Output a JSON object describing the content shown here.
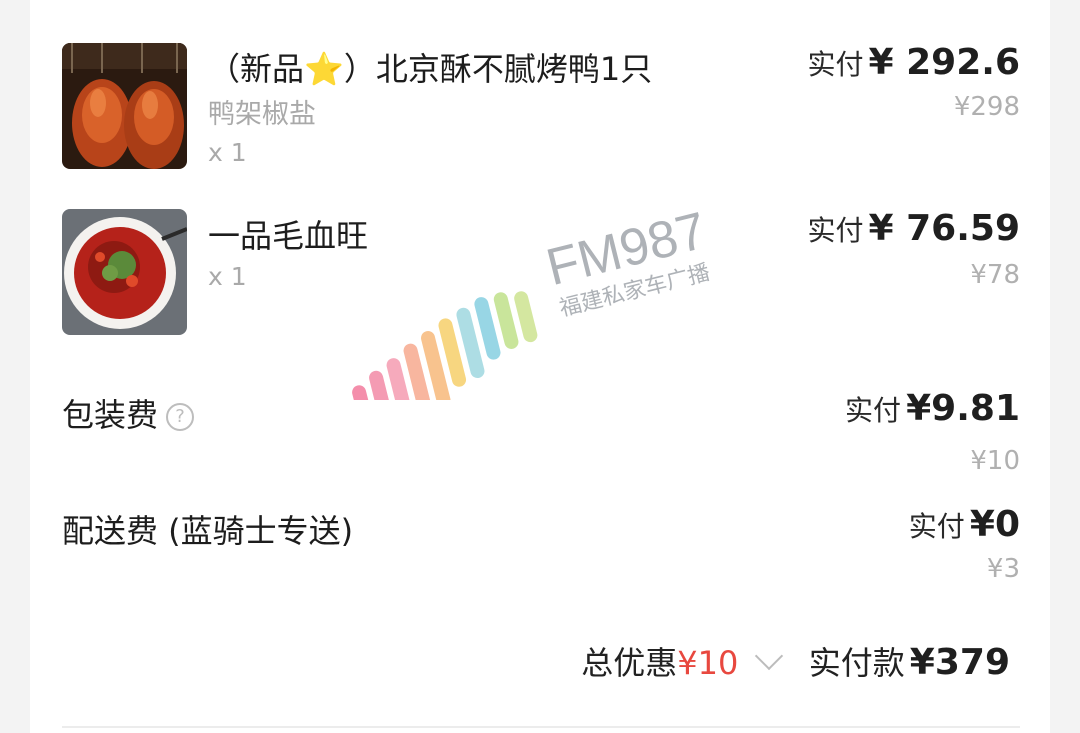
{
  "items": [
    {
      "title": "（新品⭐）北京酥不腻烤鸭1只",
      "spec": "鸭架椒盐",
      "quantity": "x 1",
      "pay_label": "实付",
      "pay_amount": "¥ 292.6",
      "original_price": "¥298",
      "image": "roast-duck-photo"
    },
    {
      "title": "一品毛血旺",
      "quantity": "x 1",
      "pay_label": "实付",
      "pay_amount": "¥ 76.59",
      "original_price": "¥78",
      "image": "maoxuewang-photo"
    }
  ],
  "packaging": {
    "label": "包装费",
    "help_icon": "question-circle-icon",
    "pay_label": "实付",
    "pay_amount": "¥9.81",
    "original_price": "¥10"
  },
  "delivery": {
    "label": "配送费 (蓝骑士专送)",
    "pay_label": "实付",
    "pay_amount": "¥0",
    "original_price": "¥3"
  },
  "summary": {
    "discount_label": "总优惠",
    "discount_value": "¥10",
    "discount_color": "#e8483f",
    "chevron_icon": "chevron-down-icon",
    "total_label": "实付款",
    "total_value": "¥379"
  },
  "watermark": {
    "brand": "FM987",
    "tagline": "福建私家车广播"
  }
}
